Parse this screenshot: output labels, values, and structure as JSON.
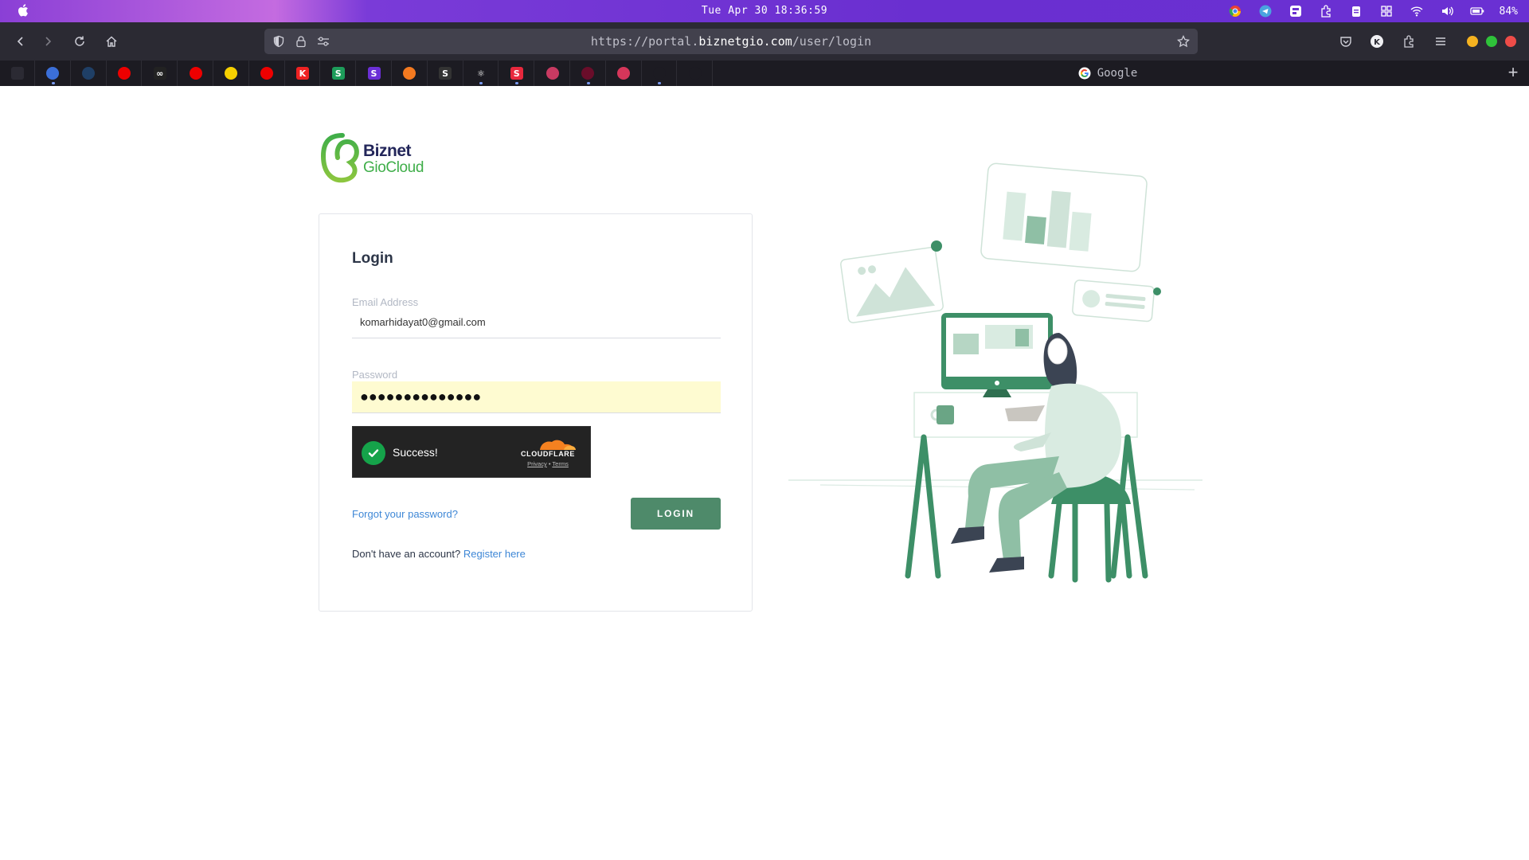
{
  "menubar": {
    "clock": "Tue Apr 30 18:36:59",
    "battery": "84%",
    "tray_icons": [
      "chrome-icon",
      "telegram-icon",
      "app-icon",
      "extension-icon",
      "clipboard-icon",
      "grid-icon",
      "wifi-icon",
      "volume-icon",
      "battery-icon"
    ]
  },
  "browser": {
    "url_prefix": "https://portal.",
    "url_domain": "biznetgio.com",
    "url_path": "/user/login",
    "active_tab_title": "Google",
    "pinned_tabs": [
      {
        "icon": "tab-list-icon",
        "color": "#2b2a33",
        "glyph": ""
      },
      {
        "icon": "chip-icon",
        "color": "#3b6fd9",
        "glyph": ""
      },
      {
        "icon": "globe-icon",
        "color": "#1f3f66",
        "glyph": ""
      },
      {
        "icon": "redhat-icon",
        "color": "#e00",
        "glyph": ""
      },
      {
        "icon": "infinity-icon",
        "color": "#222",
        "glyph": "∞"
      },
      {
        "icon": "redhat-icon",
        "color": "#e00",
        "glyph": ""
      },
      {
        "icon": "duck-icon",
        "color": "#f6d000",
        "glyph": ""
      },
      {
        "icon": "openshift-icon",
        "color": "#e00",
        "glyph": ""
      },
      {
        "icon": "k-icon",
        "color": "#e22",
        "glyph": "K"
      },
      {
        "icon": "s-green-icon",
        "color": "#1d9c5a",
        "glyph": "S"
      },
      {
        "icon": "s-purple-icon",
        "color": "#6b2fd6",
        "glyph": "S"
      },
      {
        "icon": "box-icon",
        "color": "#f47a20",
        "glyph": ""
      },
      {
        "icon": "s-dark-icon",
        "color": "#333",
        "glyph": "S"
      },
      {
        "icon": "react-icon",
        "color": "#1c1b22",
        "glyph": "⚛"
      },
      {
        "icon": "s-red-icon",
        "color": "#e8283d",
        "glyph": "S"
      },
      {
        "icon": "hex-icon",
        "color": "#c93a62",
        "glyph": ""
      },
      {
        "icon": "circle-red-icon",
        "color": "#6a0d2a",
        "glyph": ""
      },
      {
        "icon": "hex-orange-icon",
        "color": "#d6365a",
        "glyph": ""
      },
      {
        "icon": "cloudflare-icon",
        "color": "#1c1b22",
        "glyph": ""
      },
      {
        "icon": "biznet-icon",
        "color": "#1c1b22",
        "glyph": ""
      }
    ]
  },
  "logo": {
    "line1": "Biznet",
    "line2": "GioCloud"
  },
  "login": {
    "title": "Login",
    "email_label": "Email Address",
    "email_value": "komarhidayat0@gmail.com",
    "password_label": "Password",
    "password_value": "●●●●●●●●●●●●●●",
    "captcha_status": "Success!",
    "captcha_brand": "CLOUDFLARE",
    "captcha_privacy": "Privacy",
    "captcha_sep": "•",
    "captcha_terms": "Terms",
    "forgot_link": "Forgot your password?",
    "login_button": "LOGIN",
    "register_prompt": "Don't have an account?",
    "register_link": "Register here"
  },
  "colors": {
    "brand_green": "#3fae49",
    "button_green": "#4e8a6a",
    "link_blue": "#3e87d6",
    "autofill_yellow": "#fefbd1"
  }
}
